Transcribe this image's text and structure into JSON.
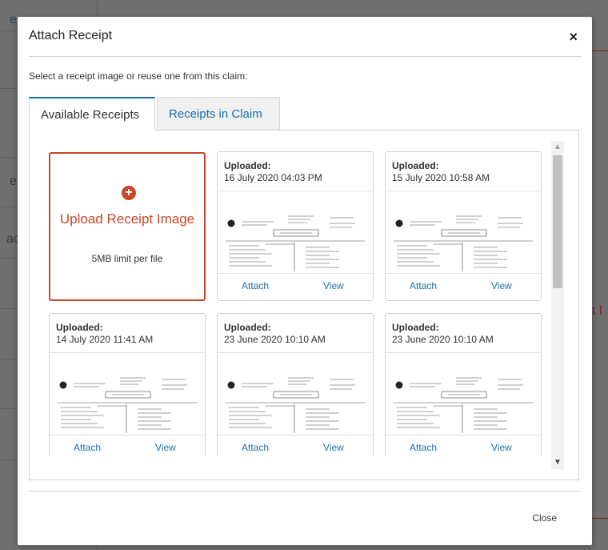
{
  "background": {
    "fragments": [
      "e",
      "e",
      "ac",
      "t l"
    ]
  },
  "modal": {
    "title": "Attach Receipt",
    "close_icon_char": "×",
    "instructions": "Select a receipt image or reuse one from this claim:",
    "tabs": [
      {
        "label": "Available Receipts",
        "active": true
      },
      {
        "label": "Receipts in Claim",
        "active": false
      }
    ],
    "upload": {
      "icon_char": "+",
      "label": "Upload Receipt Image",
      "limit": "5MB limit per file"
    },
    "receipts": [
      {
        "uploaded_label": "Uploaded:",
        "date": "16 July 2020 04:03 PM",
        "attach": "Attach",
        "view": "View"
      },
      {
        "uploaded_label": "Uploaded:",
        "date": "15 July 2020 10:58 AM",
        "attach": "Attach",
        "view": "View"
      },
      {
        "uploaded_label": "Uploaded:",
        "date": "14 July 2020 11:41 AM",
        "attach": "Attach",
        "view": "View"
      },
      {
        "uploaded_label": "Uploaded:",
        "date": "23 June 2020 10:10 AM",
        "attach": "Attach",
        "view": "View"
      },
      {
        "uploaded_label": "Uploaded:",
        "date": "23 June 2020 10:10 AM",
        "attach": "Attach",
        "view": "View"
      }
    ],
    "scroll": {
      "up": "▲",
      "down": "▼"
    },
    "footer": {
      "close_label": "Close"
    },
    "colors": {
      "accent_link": "#1b6fa8",
      "upload_accent": "#c8462a"
    }
  }
}
